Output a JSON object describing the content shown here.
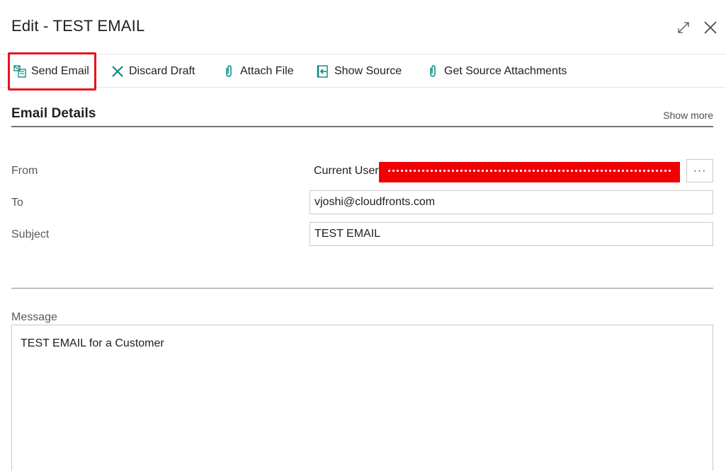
{
  "header": {
    "title": "Edit - TEST EMAIL"
  },
  "actions": {
    "send": "Send Email",
    "discard": "Discard Draft",
    "attach": "Attach File",
    "show_source": "Show Source",
    "get_source_attachments": "Get Source Attachments"
  },
  "icons": {
    "send": "send-email-icon",
    "discard": "x-icon",
    "attach": "paperclip-icon",
    "show_source": "show-source-icon",
    "get_source_attachments": "paperclip-icon",
    "expand": "expand-icon",
    "close": "close-icon"
  },
  "section": {
    "title": "Email Details",
    "show_more": "Show more"
  },
  "fields": {
    "from_label": "From",
    "from_value": "Current User",
    "to_label": "To",
    "to_value": "vjoshi@cloudfronts.com",
    "subject_label": "Subject",
    "subject_value": "TEST EMAIL",
    "lookup_button": "···"
  },
  "message": {
    "label": "Message",
    "body": "TEST EMAIL for a Customer"
  },
  "colors": {
    "highlight": "#e8121a",
    "redaction": "#f00000",
    "accent_teal": "#00857c"
  }
}
